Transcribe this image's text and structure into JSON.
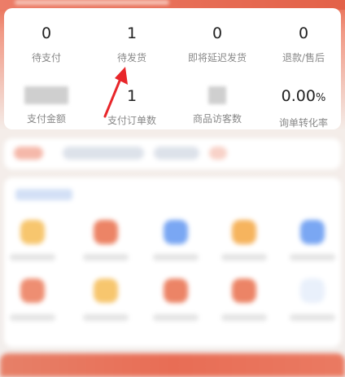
{
  "stats": {
    "pending_payment": {
      "value": "0",
      "label": "待支付"
    },
    "pending_shipment": {
      "value": "1",
      "label": "待发货"
    },
    "shipping_delayed": {
      "value": "0",
      "label": "即将延迟发货"
    },
    "refund": {
      "value": "0",
      "label": "退款/售后"
    },
    "payment_amount": {
      "label": "支付金额"
    },
    "paid_orders": {
      "value": "1",
      "label": "支付订单数"
    },
    "product_visitors": {
      "label": "商品访客数"
    },
    "inquiry_conversion": {
      "value": "0.00",
      "unit": "%",
      "label": "询单转化率"
    }
  },
  "colors": {
    "header_red": "#e86a50",
    "annotation_arrow": "#e8262a",
    "card_bg": "#ffffff",
    "number_text": "#222222",
    "label_text": "#888888"
  }
}
